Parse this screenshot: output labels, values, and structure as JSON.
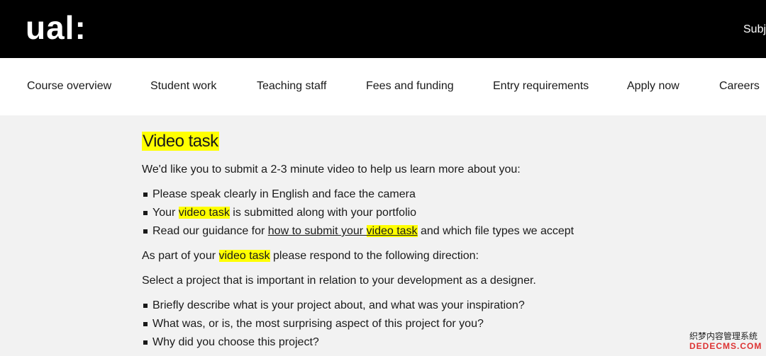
{
  "header": {
    "logo": "ual:",
    "top_link": "Subj"
  },
  "nav": {
    "items": [
      {
        "label": "Course overview"
      },
      {
        "label": "Student work"
      },
      {
        "label": "Teaching staff"
      },
      {
        "label": "Fees and funding"
      },
      {
        "label": "Entry requirements"
      },
      {
        "label": "Apply now"
      },
      {
        "label": "Careers"
      }
    ]
  },
  "content": {
    "title": "Video task",
    "intro": "We'd like you to submit a 2-3 minute video to help us learn more about you:",
    "list1": {
      "item1": "Please speak clearly in English and face the camera",
      "item2_pre": "Your ",
      "item2_hl": "video task",
      "item2_post": " is submitted along with your portfolio",
      "item3_pre": "Read our guidance for ",
      "item3_link_a": "how to submit your ",
      "item3_link_hl": "video task",
      "item3_post": " and which file types we accept"
    },
    "para2_pre": "As part of your ",
    "para2_hl": "video task",
    "para2_post": " please respond to the following direction:",
    "para3": "Select a project that is important in relation to your development as a designer.",
    "list2": [
      "Briefly describe what is your project about, and what was your inspiration?",
      "What was, or is, the most surprising aspect of this project for you?",
      "Why did you choose this project?"
    ]
  },
  "watermark": {
    "line1": "织梦内容管理系统",
    "line2": "DEDECMS.COM"
  },
  "colors": {
    "highlight": "#ffff00",
    "header_bg": "#000000",
    "page_bg": "#f2f2f2"
  }
}
